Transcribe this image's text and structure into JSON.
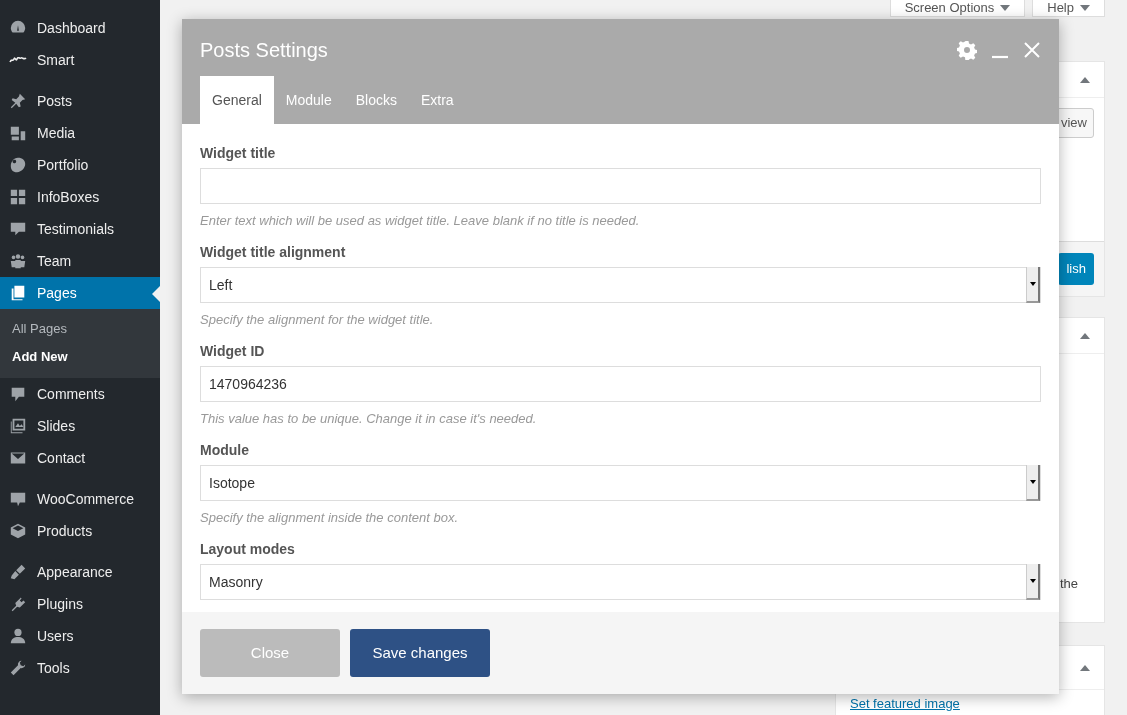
{
  "sidebar": {
    "groups": [
      [
        {
          "label": "Dashboard",
          "selected": false
        },
        {
          "label": "Smart",
          "selected": false
        }
      ],
      [
        {
          "label": "Posts",
          "selected": false
        },
        {
          "label": "Media",
          "selected": false
        },
        {
          "label": "Portfolio",
          "selected": false
        },
        {
          "label": "InfoBoxes",
          "selected": false
        },
        {
          "label": "Testimonials",
          "selected": false
        },
        {
          "label": "Team",
          "selected": false
        },
        {
          "label": "Pages",
          "selected": true,
          "children": [
            {
              "label": "All Pages",
              "selected": false
            },
            {
              "label": "Add New",
              "selected": true
            }
          ]
        },
        {
          "label": "Comments",
          "selected": false
        },
        {
          "label": "Slides",
          "selected": false
        },
        {
          "label": "Contact",
          "selected": false
        }
      ],
      [
        {
          "label": "WooCommerce",
          "selected": false
        },
        {
          "label": "Products",
          "selected": false
        }
      ],
      [
        {
          "label": "Appearance",
          "selected": false
        },
        {
          "label": "Plugins",
          "selected": false
        },
        {
          "label": "Users",
          "selected": false
        },
        {
          "label": "Tools",
          "selected": false
        }
      ]
    ]
  },
  "screen_tabs": [
    "Screen Options",
    "Help"
  ],
  "background": {
    "preview_button": "view",
    "publish_button": "lish",
    "box_text": "the",
    "featured_image_link": "Set featured image"
  },
  "modal": {
    "title": "Posts Settings",
    "tabs": [
      {
        "label": "General",
        "selected": true
      },
      {
        "label": "Module",
        "selected": false
      },
      {
        "label": "Blocks",
        "selected": false
      },
      {
        "label": "Extra",
        "selected": false
      }
    ],
    "fields": [
      {
        "kind": "text",
        "label": "Widget title",
        "help": "Enter text which will be used as widget title. Leave blank if no title is needed."
      },
      {
        "kind": "select",
        "label": "Widget title alignment",
        "value": "Left",
        "help": "Specify the alignment for the widget title."
      },
      {
        "kind": "text",
        "label": "Widget ID",
        "value": "1470964236",
        "help": "This value has to be unique. Change it in case it's needed."
      },
      {
        "kind": "select",
        "label": "Module",
        "value": "Isotope",
        "help": "Specify the alignment inside the content box."
      },
      {
        "kind": "select",
        "label": "Layout modes",
        "value": "Masonry"
      }
    ],
    "buttons": [
      {
        "label": "Close",
        "kind": "secondary"
      },
      {
        "label": "Save changes",
        "kind": "primary"
      }
    ]
  }
}
